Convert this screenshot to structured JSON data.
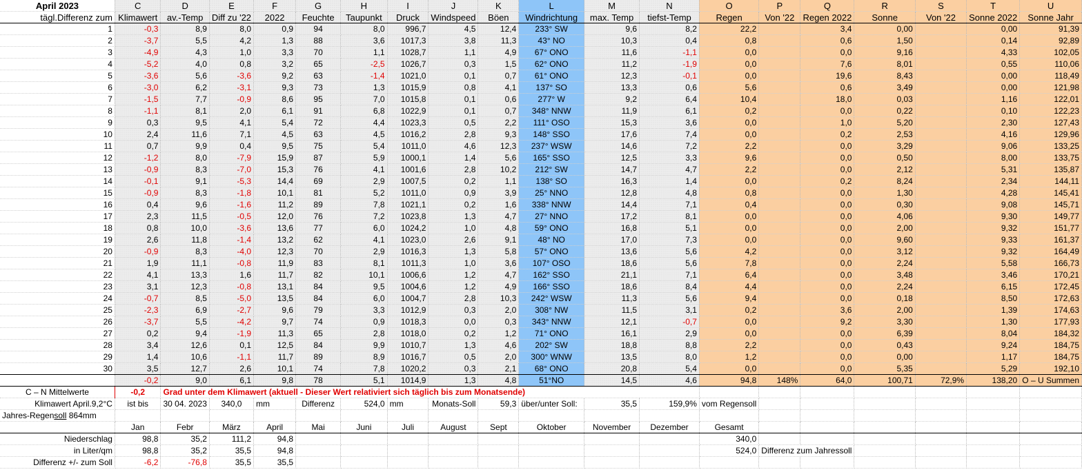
{
  "title": "April 2023",
  "col_letters": [
    "C",
    "D",
    "E",
    "F",
    "G",
    "H",
    "I",
    "J",
    "K",
    "L",
    "M",
    "N",
    "O",
    "P",
    "Q",
    "R",
    "S",
    "T",
    "U"
  ],
  "row_label_header": "tägl.Differenz zum",
  "col_names": [
    "Klimawert",
    "av.-Temp",
    "Diff zu '22",
    "2022",
    "Feuchte",
    "Taupunkt",
    "Druck",
    "Windspeed",
    "Böen",
    "Windrichtung",
    "max. Temp",
    "tiefst-Temp",
    "Regen",
    "Von '22",
    "Regen 2022",
    "Sonne",
    "Von '22",
    "Sonne 2022",
    "Sonne Jahr"
  ],
  "days": [
    [
      "1",
      "-0,3",
      "8,9",
      "8,0",
      "0,9",
      "94",
      "8,0",
      "996,7",
      "4,5",
      "12,4",
      "233° SW",
      "9,6",
      "8,2",
      "22,2",
      "",
      "3,4",
      "0,00",
      "",
      "0,00",
      "91,39"
    ],
    [
      "2",
      "-3,7",
      "5,5",
      "4,2",
      "1,3",
      "88",
      "3,6",
      "1017,3",
      "3,8",
      "11,3",
      "43° NO",
      "10,3",
      "0,4",
      "0,8",
      "",
      "0,6",
      "1,50",
      "",
      "0,14",
      "92,89"
    ],
    [
      "3",
      "-4,9",
      "4,3",
      "1,0",
      "3,3",
      "70",
      "1,1",
      "1028,7",
      "1,1",
      "4,9",
      "67° ONO",
      "11,6",
      "-1,1",
      "0,0",
      "",
      "0,0",
      "9,16",
      "",
      "4,33",
      "102,05"
    ],
    [
      "4",
      "-5,2",
      "4,0",
      "0,8",
      "3,2",
      "65",
      "-2,5",
      "1026,7",
      "0,3",
      "1,5",
      "62° ONO",
      "11,2",
      "-1,9",
      "0,0",
      "",
      "7,6",
      "8,01",
      "",
      "0,55",
      "110,06"
    ],
    [
      "5",
      "-3,6",
      "5,6",
      "-3,6",
      "9,2",
      "63",
      "-1,4",
      "1021,0",
      "0,1",
      "0,7",
      "61° ONO",
      "12,3",
      "-0,1",
      "0,0",
      "",
      "19,6",
      "8,43",
      "",
      "0,00",
      "118,49"
    ],
    [
      "6",
      "-3,0",
      "6,2",
      "-3,1",
      "9,3",
      "73",
      "1,3",
      "1015,9",
      "0,8",
      "4,1",
      "137° SO",
      "13,3",
      "0,6",
      "5,6",
      "",
      "0,6",
      "3,49",
      "",
      "0,00",
      "121,98"
    ],
    [
      "7",
      "-1,5",
      "7,7",
      "-0,9",
      "8,6",
      "95",
      "7,0",
      "1015,8",
      "0,1",
      "0,6",
      "277° W",
      "9,2",
      "6,4",
      "10,4",
      "",
      "18,0",
      "0,03",
      "",
      "1,16",
      "122,01"
    ],
    [
      "8",
      "-1,1",
      "8,1",
      "2,0",
      "6,1",
      "91",
      "6,8",
      "1022,9",
      "0,1",
      "0,7",
      "348° NNW",
      "11,9",
      "6,1",
      "0,2",
      "",
      "0,0",
      "0,22",
      "",
      "0,10",
      "122,23"
    ],
    [
      "9",
      "0,3",
      "9,5",
      "4,1",
      "5,4",
      "72",
      "4,4",
      "1023,3",
      "0,5",
      "2,2",
      "111° OSO",
      "15,3",
      "3,6",
      "0,0",
      "",
      "1,0",
      "5,20",
      "",
      "2,30",
      "127,43"
    ],
    [
      "10",
      "2,4",
      "11,6",
      "7,1",
      "4,5",
      "63",
      "4,5",
      "1016,2",
      "2,8",
      "9,3",
      "148° SSO",
      "17,6",
      "7,4",
      "0,0",
      "",
      "0,2",
      "2,53",
      "",
      "4,16",
      "129,96"
    ],
    [
      "11",
      "0,7",
      "9,9",
      "0,4",
      "9,5",
      "75",
      "5,4",
      "1011,0",
      "4,6",
      "12,3",
      "237° WSW",
      "14,6",
      "7,2",
      "2,2",
      "",
      "0,0",
      "3,29",
      "",
      "9,06",
      "133,25"
    ],
    [
      "12",
      "-1,2",
      "8,0",
      "-7,9",
      "15,9",
      "87",
      "5,9",
      "1000,1",
      "1,4",
      "5,6",
      "165° SSO",
      "12,5",
      "3,3",
      "9,6",
      "",
      "0,0",
      "0,50",
      "",
      "8,00",
      "133,75"
    ],
    [
      "13",
      "-0,9",
      "8,3",
      "-7,0",
      "15,3",
      "76",
      "4,1",
      "1001,6",
      "2,8",
      "10,2",
      "212° SW",
      "14,7",
      "4,7",
      "2,2",
      "",
      "0,0",
      "2,12",
      "",
      "5,31",
      "135,87"
    ],
    [
      "14",
      "-0,1",
      "9,1",
      "-5,3",
      "14,4",
      "69",
      "2,9",
      "1007,5",
      "0,2",
      "1,1",
      "138° SO",
      "16,3",
      "1,4",
      "0,0",
      "",
      "0,2",
      "8,24",
      "",
      "2,34",
      "144,11"
    ],
    [
      "15",
      "-0,9",
      "8,3",
      "-1,8",
      "10,1",
      "81",
      "5,2",
      "1011,0",
      "0,9",
      "3,9",
      "25° NNO",
      "12,8",
      "4,8",
      "0,8",
      "",
      "0,0",
      "1,30",
      "",
      "4,28",
      "145,41"
    ],
    [
      "16",
      "0,4",
      "9,6",
      "-1,6",
      "11,2",
      "89",
      "7,8",
      "1021,1",
      "0,2",
      "1,6",
      "338° NNW",
      "14,4",
      "7,1",
      "0,4",
      "",
      "0,0",
      "0,30",
      "",
      "9,08",
      "145,71"
    ],
    [
      "17",
      "2,3",
      "11,5",
      "-0,5",
      "12,0",
      "76",
      "7,2",
      "1023,8",
      "1,3",
      "4,7",
      "27° NNO",
      "17,2",
      "8,1",
      "0,0",
      "",
      "0,0",
      "4,06",
      "",
      "9,30",
      "149,77"
    ],
    [
      "18",
      "0,8",
      "10,0",
      "-3,6",
      "13,6",
      "77",
      "6,0",
      "1024,2",
      "1,0",
      "4,8",
      "59° ONO",
      "16,8",
      "5,1",
      "0,0",
      "",
      "0,0",
      "2,00",
      "",
      "9,32",
      "151,77"
    ],
    [
      "19",
      "2,6",
      "11,8",
      "-1,4",
      "13,2",
      "62",
      "4,1",
      "1023,0",
      "2,6",
      "9,1",
      "48° NO",
      "17,0",
      "7,3",
      "0,0",
      "",
      "0,0",
      "9,60",
      "",
      "9,33",
      "161,37"
    ],
    [
      "20",
      "-0,9",
      "8,3",
      "-4,0",
      "12,3",
      "70",
      "2,9",
      "1016,3",
      "1,3",
      "5,8",
      "57° ONO",
      "13,6",
      "5,6",
      "4,2",
      "",
      "0,0",
      "3,12",
      "",
      "9,32",
      "164,49"
    ],
    [
      "21",
      "1,9",
      "11,1",
      "-0,8",
      "11,9",
      "83",
      "8,1",
      "1011,3",
      "1,0",
      "3,6",
      "107° OSO",
      "18,6",
      "5,6",
      "7,8",
      "",
      "0,0",
      "2,24",
      "",
      "5,58",
      "166,73"
    ],
    [
      "22",
      "4,1",
      "13,3",
      "1,6",
      "11,7",
      "82",
      "10,1",
      "1006,6",
      "1,2",
      "4,7",
      "162° SSO",
      "21,1",
      "7,1",
      "6,4",
      "",
      "0,0",
      "3,48",
      "",
      "3,46",
      "170,21"
    ],
    [
      "23",
      "3,1",
      "12,3",
      "-0,8",
      "13,1",
      "84",
      "9,5",
      "1004,6",
      "1,2",
      "4,9",
      "166° SSO",
      "18,6",
      "8,4",
      "4,4",
      "",
      "0,0",
      "2,24",
      "",
      "6,15",
      "172,45"
    ],
    [
      "24",
      "-0,7",
      "8,5",
      "-5,0",
      "13,5",
      "84",
      "6,0",
      "1004,7",
      "2,8",
      "10,3",
      "242° WSW",
      "11,3",
      "5,6",
      "9,4",
      "",
      "0,0",
      "0,18",
      "",
      "8,50",
      "172,63"
    ],
    [
      "25",
      "-2,3",
      "6,9",
      "-2,7",
      "9,6",
      "79",
      "3,3",
      "1012,9",
      "0,3",
      "2,0",
      "308° NW",
      "11,5",
      "3,1",
      "0,2",
      "",
      "3,6",
      "2,00",
      "",
      "1,39",
      "174,63"
    ],
    [
      "26",
      "-3,7",
      "5,5",
      "-4,2",
      "9,7",
      "74",
      "0,9",
      "1018,3",
      "0,0",
      "0,3",
      "343° NNW",
      "12,1",
      "-0,7",
      "0,0",
      "",
      "9,2",
      "3,30",
      "",
      "1,30",
      "177,93"
    ],
    [
      "27",
      "0,2",
      "9,4",
      "-1,9",
      "11,3",
      "65",
      "2,8",
      "1018,0",
      "0,2",
      "1,2",
      "71° ONO",
      "16,1",
      "2,9",
      "0,0",
      "",
      "0,0",
      "6,39",
      "",
      "8,04",
      "184,32"
    ],
    [
      "28",
      "3,4",
      "12,6",
      "0,1",
      "12,5",
      "84",
      "9,9",
      "1010,7",
      "1,3",
      "4,6",
      "202° SW",
      "18,8",
      "8,8",
      "2,2",
      "",
      "0,0",
      "0,43",
      "",
      "9,24",
      "184,75"
    ],
    [
      "29",
      "1,4",
      "10,6",
      "-1,1",
      "11,7",
      "89",
      "8,9",
      "1016,7",
      "0,5",
      "2,0",
      "300° WNW",
      "13,5",
      "8,0",
      "1,2",
      "",
      "0,0",
      "0,00",
      "",
      "1,17",
      "184,75"
    ],
    [
      "30",
      "3,5",
      "12,7",
      "2,6",
      "10,1",
      "74",
      "7,8",
      "1020,2",
      "0,3",
      "2,1",
      "68° ONO",
      "20,8",
      "5,4",
      "0,0",
      "",
      "0,0",
      "5,35",
      "",
      "5,29",
      "192,10"
    ]
  ],
  "sums": [
    "",
    "-0,2",
    "9,0",
    "6,1",
    "9,8",
    "78",
    "5,1",
    "1014,9",
    "1,3",
    "4,8",
    "51°NO",
    "14,5",
    "4,6",
    "94,8",
    "148%",
    "64,0",
    "100,71",
    "72,9%",
    "138,20",
    "O – U Summen"
  ],
  "mittel": {
    "label": "C – N Mittelwerte",
    "value": "-0,2",
    "note": "Grad unter dem Klimawert (aktuell - Dieser Wert relativiert sich täglich bis zum Monatsende)"
  },
  "klima": {
    "label": "Klimawert April.9,2°C",
    "ist_bis": "ist bis",
    "date": "30 04. 2023",
    "value": "340,0",
    "unit": "mm",
    "diff_label": "Differenz",
    "diff_value": "524,0",
    "diff_unit": "mm",
    "monats_soll_label": "Monats-Soll",
    "monats_soll_value": "59,3",
    "ueber_label": "über/unter Soll:",
    "ueber_value": "35,5",
    "percent": "159,9%",
    "vom": "vom Regensoll"
  },
  "jahres_regensoll": {
    "prefix": "Jahres-Regen",
    "underlined": "soll",
    "suffix": " 864mm"
  },
  "months": [
    "Jan",
    "Febr",
    "März",
    "April",
    "Mai",
    "Juni",
    "Juli",
    "August",
    "Sept",
    "Oktober",
    "November",
    "Dezember",
    "Gesamt"
  ],
  "niederschlag": {
    "label": "Niederschlag",
    "values": [
      "98,8",
      "35,2",
      "111,2",
      "94,8"
    ],
    "gesamt": "340,0"
  },
  "liter": {
    "label": "in Liter/qm",
    "values": [
      "98,8",
      "35,2",
      "35,5",
      "94,8"
    ],
    "gesamt": "524,0",
    "note": "Differenz zum Jahressoll"
  },
  "differenz": {
    "label": "Differenz  +/- zum Soll",
    "values": [
      "-6,2",
      "-76,8",
      "35,5",
      "35,5"
    ]
  }
}
